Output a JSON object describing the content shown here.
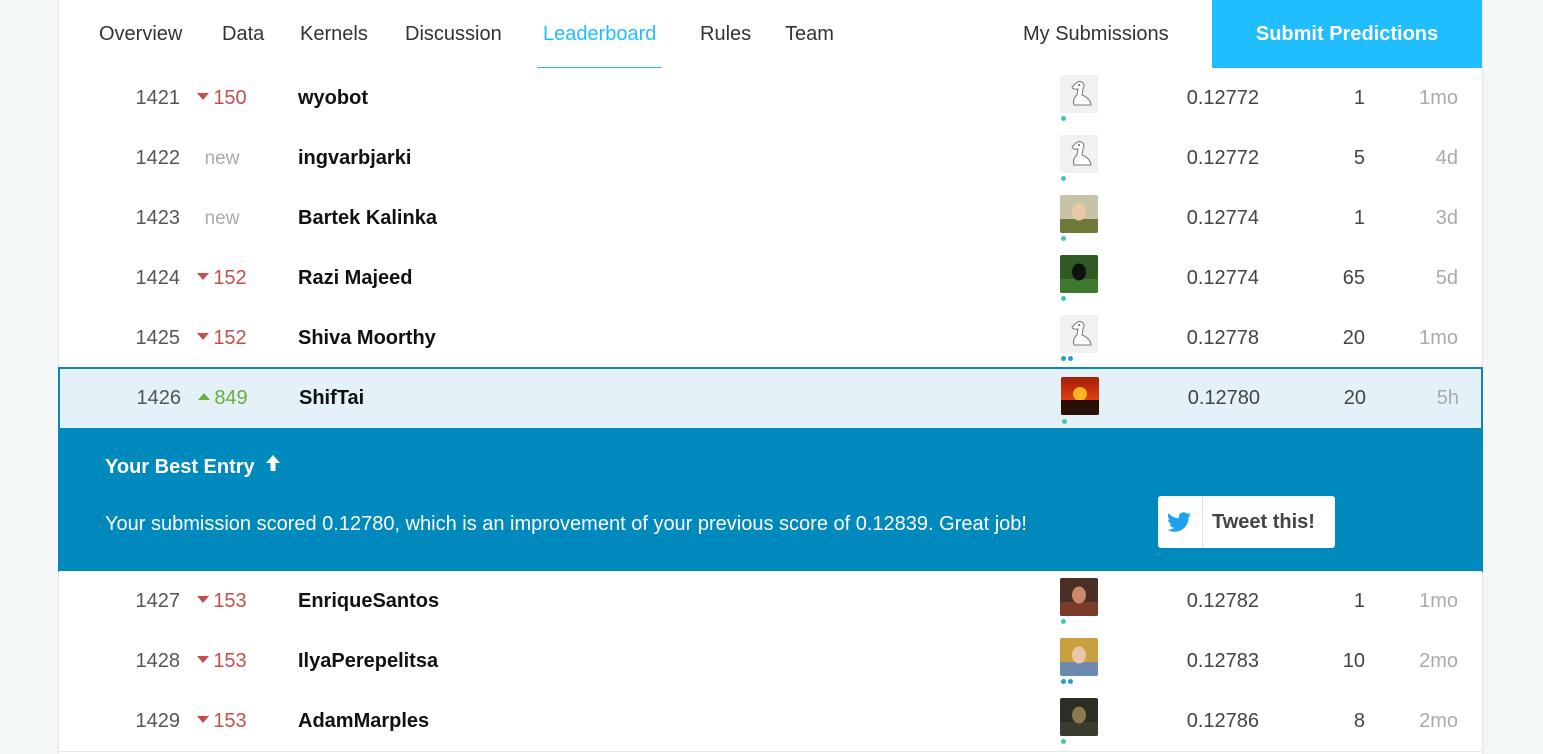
{
  "nav": {
    "tabs": [
      "Overview",
      "Data",
      "Kernels",
      "Discussion",
      "Leaderboard",
      "Rules",
      "Team"
    ],
    "active_tab": "Leaderboard",
    "my_submissions": "My Submissions",
    "submit_predictions": "Submit Predictions"
  },
  "rows_before": [
    {
      "rank": "1421",
      "change": "150",
      "dir": "down",
      "name": "wyobot",
      "avatar": "goose-avatar",
      "tier": "novice",
      "score": "0.12772",
      "entries": "1",
      "last": "1mo"
    },
    {
      "rank": "1422",
      "change": "new",
      "dir": "new",
      "name": "ingvarbjarki",
      "avatar": "goose-avatar",
      "tier": "novice",
      "score": "0.12772",
      "entries": "5",
      "last": "4d"
    },
    {
      "rank": "1423",
      "change": "new",
      "dir": "new",
      "name": "Bartek Kalinka",
      "avatar": "photo-avatar",
      "tier": "novice",
      "score": "0.12774",
      "entries": "1",
      "last": "3d"
    },
    {
      "rank": "1424",
      "change": "152",
      "dir": "down",
      "name": "Razi Majeed",
      "avatar": "photo-avatar",
      "tier": "novice",
      "score": "0.12774",
      "entries": "65",
      "last": "5d"
    },
    {
      "rank": "1425",
      "change": "152",
      "dir": "down",
      "name": "Shiva Moorthy",
      "avatar": "goose-avatar",
      "tier": "contributor",
      "score": "0.12778",
      "entries": "20",
      "last": "1mo"
    }
  ],
  "my_row": {
    "rank": "1426",
    "change": "849",
    "dir": "up",
    "name": "ShifTai",
    "avatar": "sunset-avatar",
    "tier": "novice",
    "score": "0.12780",
    "entries": "20",
    "last": "5h"
  },
  "best_entry": {
    "title": "Your Best Entry",
    "message": "Your submission scored 0.12780, which is an improvement of your previous score of 0.12839. Great job!",
    "tweet_label": "Tweet this!"
  },
  "rows_after": [
    {
      "rank": "1427",
      "change": "153",
      "dir": "down",
      "name": "EnriqueSantos",
      "avatar": "photo-avatar",
      "tier": "novice",
      "score": "0.12782",
      "entries": "1",
      "last": "1mo"
    },
    {
      "rank": "1428",
      "change": "153",
      "dir": "down",
      "name": "IlyaPerepelitsa",
      "avatar": "photo-avatar",
      "tier": "contributor",
      "score": "0.12783",
      "entries": "10",
      "last": "2mo"
    },
    {
      "rank": "1429",
      "change": "153",
      "dir": "down",
      "name": "AdamMarples",
      "avatar": "photo-avatar",
      "tier": "novice",
      "score": "0.12786",
      "entries": "8",
      "last": "2mo"
    }
  ],
  "colors": {
    "accent": "#20beff",
    "banner": "#0089bd",
    "rank_down": "#c34f4f",
    "rank_up": "#6aae3e",
    "my_row_bg": "#e4f1f8"
  }
}
